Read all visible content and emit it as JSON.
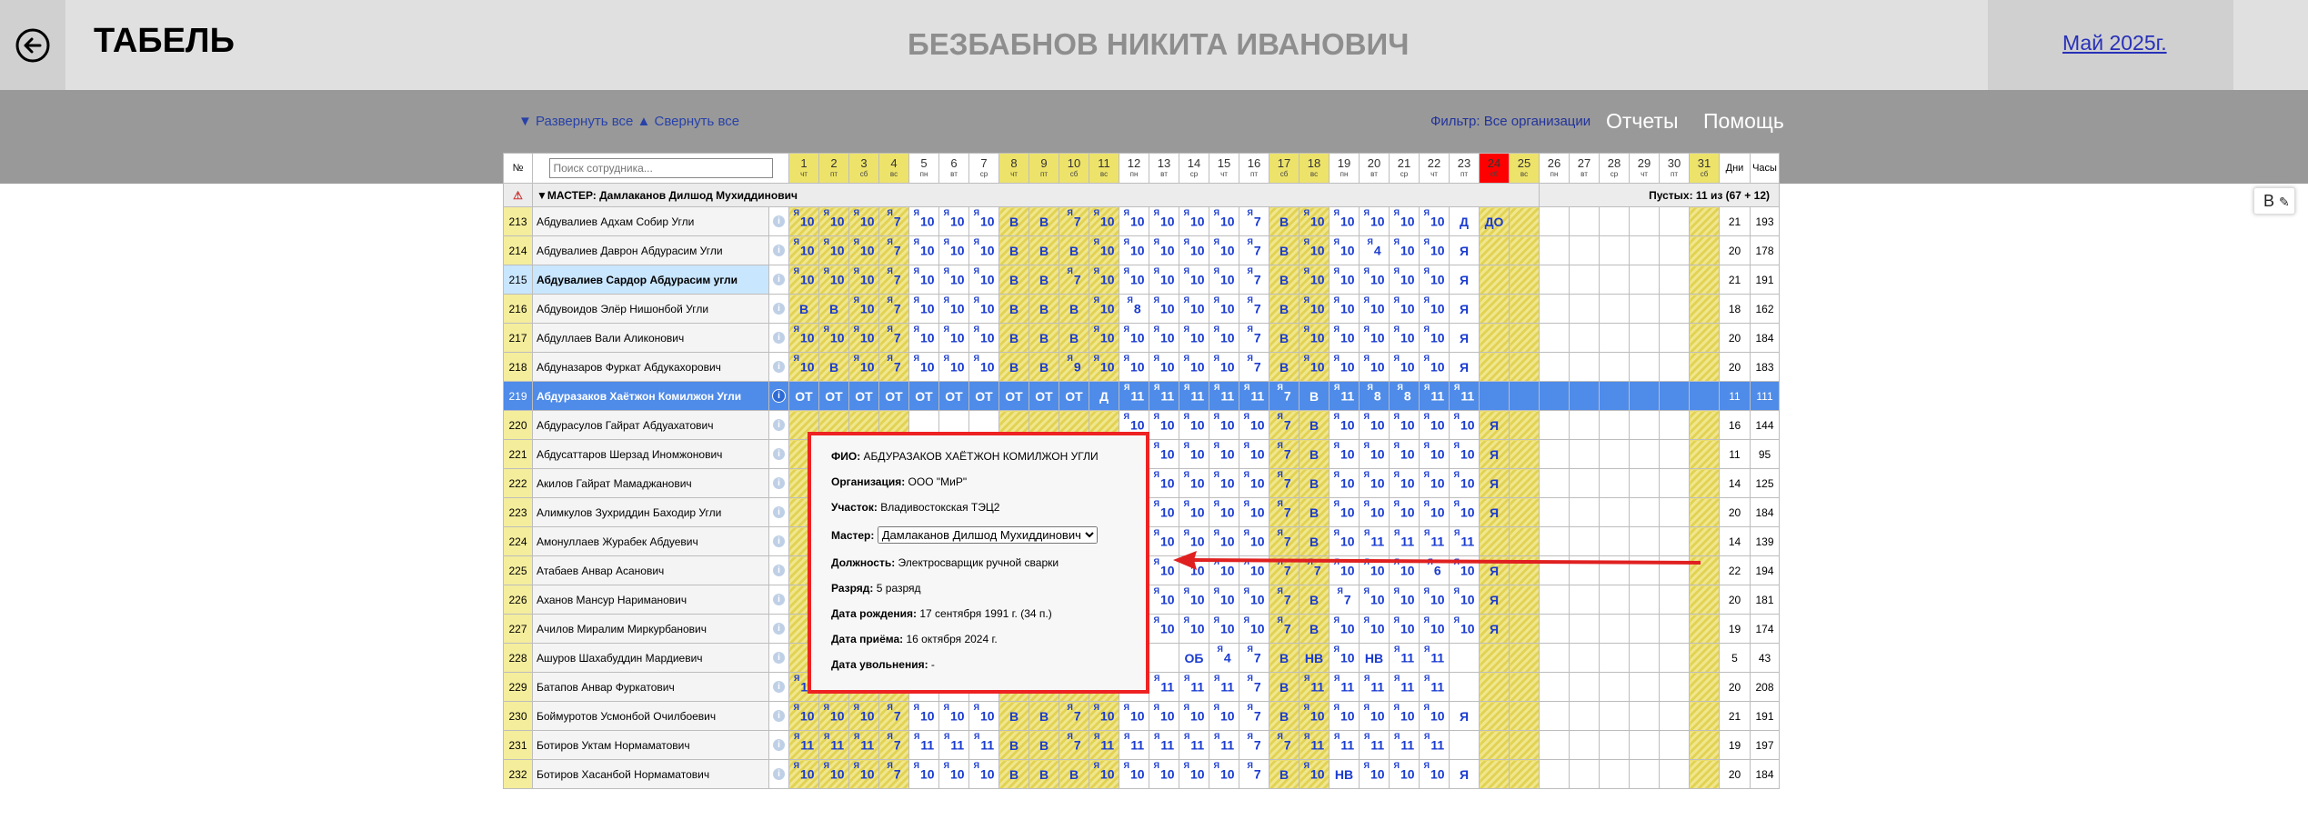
{
  "header": {
    "title": "ТАБЕЛЬ",
    "employee": "БЕЗБАБНОВ НИКИТА ИВАНОВИЧ",
    "month": "Май 2025г."
  },
  "toolbar": {
    "expand_all": "▼ Развернуть все",
    "collapse_all": "▲ Свернуть все",
    "filter": "Фильтр: Все организации",
    "reports": "Отчеты",
    "help": "Помощь"
  },
  "side_button": "В",
  "table": {
    "num_header": "№",
    "search_placeholder": "Поиск сотрудника...",
    "days_header": "Дни",
    "hours_header": "Часы",
    "days": [
      {
        "n": "1",
        "w": "чт",
        "we": true
      },
      {
        "n": "2",
        "w": "пт",
        "we": true
      },
      {
        "n": "3",
        "w": "сб",
        "we": true
      },
      {
        "n": "4",
        "w": "вс",
        "we": true
      },
      {
        "n": "5",
        "w": "пн",
        "we": false
      },
      {
        "n": "6",
        "w": "вт",
        "we": false
      },
      {
        "n": "7",
        "w": "ср",
        "we": false
      },
      {
        "n": "8",
        "w": "чт",
        "we": true
      },
      {
        "n": "9",
        "w": "пт",
        "we": true
      },
      {
        "n": "10",
        "w": "сб",
        "we": true
      },
      {
        "n": "11",
        "w": "вс",
        "we": true
      },
      {
        "n": "12",
        "w": "пн",
        "we": false
      },
      {
        "n": "13",
        "w": "вт",
        "we": false
      },
      {
        "n": "14",
        "w": "ср",
        "we": false
      },
      {
        "n": "15",
        "w": "чт",
        "we": false
      },
      {
        "n": "16",
        "w": "пт",
        "we": false
      },
      {
        "n": "17",
        "w": "сб",
        "we": true
      },
      {
        "n": "18",
        "w": "вс",
        "we": true
      },
      {
        "n": "19",
        "w": "пн",
        "we": false
      },
      {
        "n": "20",
        "w": "вт",
        "we": false
      },
      {
        "n": "21",
        "w": "ср",
        "we": false
      },
      {
        "n": "22",
        "w": "чт",
        "we": false
      },
      {
        "n": "23",
        "w": "пт",
        "we": false
      },
      {
        "n": "24",
        "w": "сб",
        "we": true,
        "today": true
      },
      {
        "n": "25",
        "w": "вс",
        "we": true
      },
      {
        "n": "26",
        "w": "пн",
        "we": false
      },
      {
        "n": "27",
        "w": "вт",
        "we": false
      },
      {
        "n": "28",
        "w": "ср",
        "we": false
      },
      {
        "n": "29",
        "w": "чт",
        "we": false
      },
      {
        "n": "30",
        "w": "пт",
        "we": false
      },
      {
        "n": "31",
        "w": "сб",
        "we": true
      }
    ],
    "group": {
      "label": "▼МАСТЕР: Дамлаканов Дилшод Мухиддинович",
      "empty": "Пустых: 11 из (67 + 12)"
    },
    "rows": [
      {
        "num": "213",
        "name": "Абдувалиев Адхам Собир Угли",
        "cells": [
          "Я10",
          "Я10",
          "Я10",
          "Я7",
          "Я10",
          "Я10",
          "Я10",
          "В",
          "В",
          "Я7",
          "Я10",
          "Я10",
          "Я10",
          "Я10",
          "Я10",
          "Я7",
          "В",
          "Я10",
          "Я10",
          "Я10",
          "Я10",
          "Я10",
          "Д",
          "ДО"
        ],
        "days": "21",
        "hours": "193"
      },
      {
        "num": "214",
        "name": "Абдувалиев Даврон Абдурасим Угли",
        "cells": [
          "Я10",
          "Я10",
          "Я10",
          "Я7",
          "Я10",
          "Я10",
          "Я10",
          "В",
          "В",
          "В",
          "Я10",
          "Я10",
          "Я10",
          "Я10",
          "Я10",
          "Я7",
          "В",
          "Я10",
          "Я10",
          "Я4",
          "Я10",
          "Я10",
          "Я",
          ""
        ],
        "days": "20",
        "hours": "178"
      },
      {
        "num": "215",
        "name": "Абдувалиев Сардор Абдурасим угли",
        "cells": [
          "Я10",
          "Я10",
          "Я10",
          "Я7",
          "Я10",
          "Я10",
          "Я10",
          "В",
          "В",
          "Я7",
          "Я10",
          "Я10",
          "Я10",
          "Я10",
          "Я10",
          "Я7",
          "В",
          "Я10",
          "Я10",
          "Я10",
          "Я10",
          "Я10",
          "Я",
          ""
        ],
        "days": "21",
        "hours": "191",
        "light": true
      },
      {
        "num": "216",
        "name": "Абдувоидов Элёр Нишонбой Угли",
        "cells": [
          "В",
          "В",
          "Я10",
          "Я7",
          "Я10",
          "Я10",
          "Я10",
          "В",
          "В",
          "В",
          "Я10",
          "Я8",
          "Я10",
          "Я10",
          "Я10",
          "Я7",
          "В",
          "Я10",
          "Я10",
          "Я10",
          "Я10",
          "Я10",
          "Я",
          ""
        ],
        "days": "18",
        "hours": "162"
      },
      {
        "num": "217",
        "name": "Абдуллаев Вали Аликонович",
        "cells": [
          "Я10",
          "Я10",
          "Я10",
          "Я7",
          "Я10",
          "Я10",
          "Я10",
          "В",
          "В",
          "В",
          "Я10",
          "Я10",
          "Я10",
          "Я10",
          "Я10",
          "Я7",
          "В",
          "Я10",
          "Я10",
          "Я10",
          "Я10",
          "Я10",
          "Я",
          ""
        ],
        "days": "20",
        "hours": "184"
      },
      {
        "num": "218",
        "name": "Абдуназаров Фуркат Абдукахорович",
        "cells": [
          "Я10",
          "В",
          "Я10",
          "Я7",
          "Я10",
          "Я10",
          "Я10",
          "В",
          "В",
          "Я9",
          "Я10",
          "Я10",
          "Я10",
          "Я10",
          "Я10",
          "Я7",
          "В",
          "Я10",
          "Я10",
          "Я10",
          "Я10",
          "Я10",
          "Я",
          ""
        ],
        "days": "20",
        "hours": "183"
      },
      {
        "num": "219",
        "name": "Абдуразаков Хаётжон Комилжон Угли",
        "cells": [
          "ОТ",
          "ОТ",
          "ОТ",
          "ОТ",
          "ОТ",
          "ОТ",
          "ОТ",
          "ОТ",
          "ОТ",
          "ОТ",
          "Д",
          "Я11",
          "Я11",
          "Я11",
          "Я11",
          "Я11",
          "Я7",
          "В",
          "Я11",
          "Я8",
          "Я8",
          "Я11",
          "Я11",
          ""
        ],
        "days": "11",
        "hours": "111",
        "sel": true
      },
      {
        "num": "220",
        "name": "Абдурасулов Гайрат Абдуахатович",
        "cells": [
          "",
          "",
          "",
          "",
          "",
          "",
          "",
          "",
          "",
          "",
          "",
          "Я10",
          "Я10",
          "Я10",
          "Я10",
          "Я10",
          "Я7",
          "В",
          "Я10",
          "Я10",
          "Я10",
          "Я10",
          "Я10",
          "Я"
        ],
        "days": "16",
        "hours": "144"
      },
      {
        "num": "221",
        "name": "Абдусаттаров Шерзад Иномжонович",
        "cells": [
          "",
          "",
          "",
          "",
          "",
          "",
          "",
          "",
          "",
          "",
          "",
          "ОБ",
          "Я10",
          "Я10",
          "Я10",
          "Я10",
          "Я7",
          "В",
          "Я10",
          "Я10",
          "Я10",
          "Я10",
          "Я10",
          "Я"
        ],
        "days": "11",
        "hours": "95"
      },
      {
        "num": "222",
        "name": "Акилов Гайрат Мамаджанович",
        "cells": [
          "",
          "",
          "",
          "",
          "",
          "",
          "",
          "",
          "",
          "",
          "",
          "ОБ",
          "Я10",
          "Я10",
          "Я10",
          "Я10",
          "Я7",
          "В",
          "Я10",
          "Я10",
          "Я10",
          "Я10",
          "Я10",
          "Я"
        ],
        "days": "14",
        "hours": "125"
      },
      {
        "num": "223",
        "name": "Алимкулов Зухриддин Баходир Угли",
        "cells": [
          "",
          "",
          "",
          "",
          "",
          "",
          "",
          "",
          "",
          "",
          "",
          "Я10",
          "Я10",
          "Я10",
          "Я10",
          "Я10",
          "Я7",
          "В",
          "Я10",
          "Я10",
          "Я10",
          "Я10",
          "Я10",
          "Я"
        ],
        "days": "20",
        "hours": "184"
      },
      {
        "num": "224",
        "name": "Амонуллаев Журабек Абдуевич",
        "cells": [
          "",
          "",
          "",
          "",
          "",
          "",
          "",
          "",
          "",
          "",
          "",
          "Я10",
          "Я10",
          "Я10",
          "Я10",
          "Я10",
          "Я7",
          "В",
          "Я10",
          "Я11",
          "Я11",
          "Я11",
          "Я11",
          ""
        ],
        "days": "14",
        "hours": "139"
      },
      {
        "num": "225",
        "name": "Атабаев Анвар Асанович",
        "cells": [
          "",
          "",
          "",
          "",
          "",
          "",
          "",
          "",
          "",
          "",
          "",
          "Я10",
          "Я10",
          "Я10",
          "Я10",
          "Я10",
          "Я7",
          "Я7",
          "Я10",
          "Я10",
          "Я10",
          "Я6",
          "Я10",
          "Я"
        ],
        "days": "22",
        "hours": "194"
      },
      {
        "num": "226",
        "name": "Аханов Мансур Нариманович",
        "cells": [
          "",
          "",
          "",
          "",
          "",
          "",
          "",
          "",
          "",
          "",
          "",
          "Я10",
          "Я10",
          "Я10",
          "Я10",
          "Я10",
          "Я7",
          "В",
          "Я7",
          "Я10",
          "Я10",
          "Я10",
          "Я10",
          "Я"
        ],
        "days": "20",
        "hours": "181"
      },
      {
        "num": "227",
        "name": "Ачилов Миралим Миркурбанович",
        "cells": [
          "",
          "",
          "",
          "",
          "",
          "",
          "",
          "",
          "",
          "",
          "",
          "Я10",
          "Я10",
          "Я10",
          "Я10",
          "Я10",
          "Я7",
          "В",
          "Я10",
          "Я10",
          "Я10",
          "Я10",
          "Я10",
          "Я"
        ],
        "days": "19",
        "hours": "174"
      },
      {
        "num": "228",
        "name": "Ашуров Шахабуддин Мардиевич",
        "cells": [
          "",
          "",
          "",
          "",
          "",
          "",
          "",
          "",
          "",
          "",
          "",
          "",
          "",
          "ОБ",
          "Я4",
          "Я7",
          "В",
          "НВ",
          "Я10",
          "НВ",
          "Я11",
          "Я11",
          "",
          ""
        ],
        "days": "5",
        "hours": "43"
      },
      {
        "num": "229",
        "name": "Батапов Анвар Фуркатович",
        "cells": [
          "Я11",
          "Я11",
          "Я11",
          "Я7",
          "Я11",
          "Я11",
          "Я11",
          "В",
          "В",
          "Я7",
          "Я11",
          "Я11",
          "Я11",
          "Я11",
          "Я11",
          "Я7",
          "В",
          "Я11",
          "Я11",
          "Я11",
          "Я11",
          "Я11",
          "",
          ""
        ],
        "days": "20",
        "hours": "208"
      },
      {
        "num": "230",
        "name": "Боймуротов Усмонбой Очилбоевич",
        "cells": [
          "Я10",
          "Я10",
          "Я10",
          "Я7",
          "Я10",
          "Я10",
          "Я10",
          "В",
          "В",
          "Я7",
          "Я10",
          "Я10",
          "Я10",
          "Я10",
          "Я10",
          "Я7",
          "В",
          "Я10",
          "Я10",
          "Я10",
          "Я10",
          "Я10",
          "Я",
          ""
        ],
        "days": "21",
        "hours": "191"
      },
      {
        "num": "231",
        "name": "Ботиров Уктам Нормаматович",
        "cells": [
          "Я11",
          "Я11",
          "Я11",
          "Я7",
          "Я11",
          "Я11",
          "Я11",
          "В",
          "В",
          "Я7",
          "Я11",
          "Я11",
          "Я11",
          "Я11",
          "Я11",
          "Я7",
          "Я7",
          "Я11",
          "Я11",
          "Я11",
          "Я11",
          "Я11",
          "",
          ""
        ],
        "days": "19",
        "hours": "197"
      },
      {
        "num": "232",
        "name": "Ботиров Хасанбой Нормаматович",
        "cells": [
          "Я10",
          "Я10",
          "Я10",
          "Я7",
          "Я10",
          "Я10",
          "Я10",
          "В",
          "В",
          "В",
          "Я10",
          "Я10",
          "Я10",
          "Я10",
          "Я10",
          "Я7",
          "В",
          "Я10",
          "НВ",
          "Я10",
          "Я10",
          "Я10",
          "Я",
          ""
        ],
        "days": "20",
        "hours": "184"
      }
    ]
  },
  "popup": {
    "fio_label": "ФИО:",
    "fio": "АБДУРАЗАКОВ ХАЁТЖОН КОМИЛЖОН УГЛИ",
    "org_label": "Организация:",
    "org": "ООО \"МиР\"",
    "site_label": "Участок:",
    "site": "Владивостокская ТЭЦ2",
    "master_label": "Мастер:",
    "master": "Дамлаканов Дилшод Мухиддинович",
    "position_label": "Должность:",
    "position": "Электросварщик ручной сварки",
    "grade_label": "Разряд:",
    "grade": "5 разряд",
    "birth_label": "Дата рождения:",
    "birth": "17 сентября 1991 г. (34 п.)",
    "hire_label": "Дата приёма:",
    "hire": "16 октября 2024 г.",
    "fire_label": "Дата увольнения:",
    "fire": "-"
  },
  "colors": {
    "weekend": "#ede36b",
    "selected_row": "#4f8be8",
    "highlight_row": "#c9e6ff",
    "today": "#ff0000",
    "popup_border": "#e22222",
    "arrow": "#e02020",
    "code_text": "#1a3bd0"
  }
}
